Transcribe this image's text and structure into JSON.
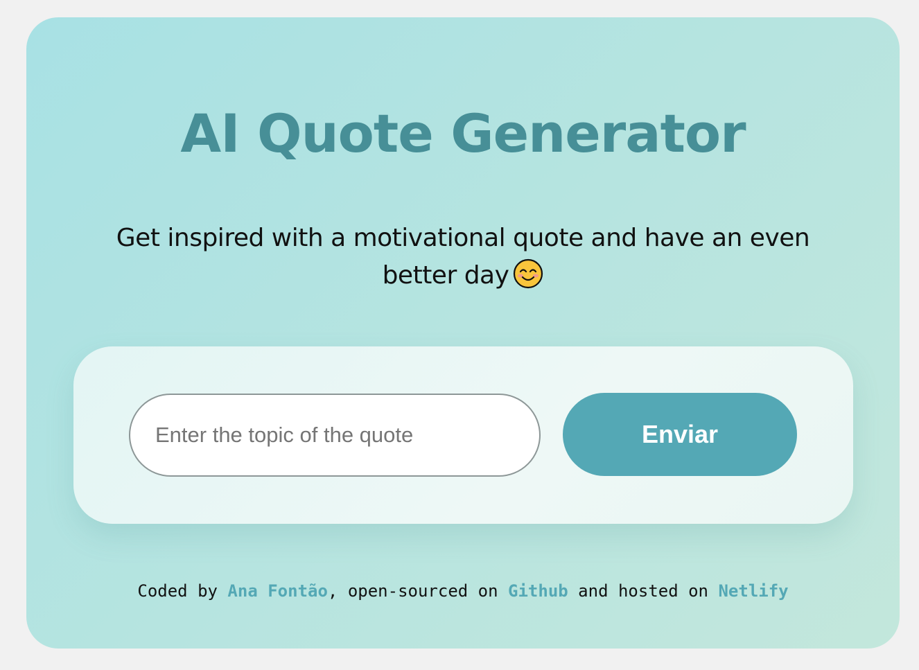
{
  "app": {
    "title": "AI Quote Generator",
    "subtitle_text": "Get inspired with a motivational quote and have an even better day",
    "subtitle_emoji": "smiling-face-with-smiling-eyes-icon"
  },
  "form": {
    "topic_input": {
      "value": "",
      "placeholder": "Enter the topic of the quote"
    },
    "submit_label": "Enviar"
  },
  "footer": {
    "coded_by_prefix": "Coded by ",
    "author_link": "Ana Fontão",
    "open_sourced_text": ", open-sourced on ",
    "github_link": "Github",
    "hosted_text": " and hosted on ",
    "netlify_link": "Netlify"
  },
  "colors": {
    "accent": "#54a8b5",
    "title": "#478f97",
    "page_background": "#f1f1f1"
  }
}
